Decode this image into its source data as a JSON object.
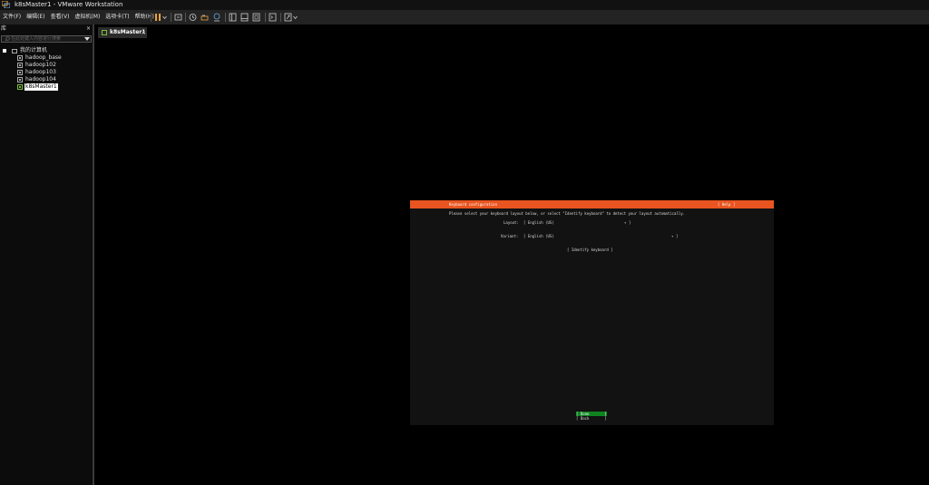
{
  "window": {
    "title": "k8sMaster1 - VMware Workstation"
  },
  "menu": {
    "items": [
      "文件(F)",
      "编辑(E)",
      "查看(V)",
      "虚拟机(M)",
      "选项卡(T)",
      "帮助(H)"
    ]
  },
  "toolbar": {
    "icons": [
      "pause-icon",
      "dropdown-icon",
      "send-keys-icon",
      "snapshot-icon",
      "revert-snapshot-icon",
      "snapshot-manager-icon",
      "library-view-icon",
      "thumbnail-view-icon",
      "full-screen-icon",
      "console-view-icon",
      "unity-icon",
      "stretch-icon"
    ],
    "accent": "#e95420"
  },
  "library": {
    "title": "库",
    "close": "×",
    "search_placeholder": "在此处键入内容进行搜索",
    "root": "我的计算机",
    "vms": [
      {
        "label": "hadoop_base",
        "state": "off"
      },
      {
        "label": "hadoop102",
        "state": "off"
      },
      {
        "label": "hadoop103",
        "state": "off"
      },
      {
        "label": "hadoop104",
        "state": "off"
      },
      {
        "label": "k8sMaster1",
        "state": "running",
        "selected": true
      }
    ]
  },
  "tab": {
    "label": "k8sMaster1",
    "close": "×"
  },
  "vm_screen": {
    "header_title": "Keyboard configuration",
    "help": "[ Help ]",
    "instruction": "Please select your keyboard layout below, or select \"Identify keyboard\" to detect your layout automatically.",
    "layout_label": "Layout:",
    "layout_value": "[ English (US)",
    "layout_end": "▾ ]",
    "variant_label": "Variant:",
    "variant_value": "[ English (US)",
    "variant_end": "▾ ]",
    "identify": "[ Identify keyboard ]",
    "done": "[ Done       ]",
    "back": "[ Back       ]",
    "colors": {
      "header": "#e95420",
      "done": "#0e8420"
    }
  }
}
